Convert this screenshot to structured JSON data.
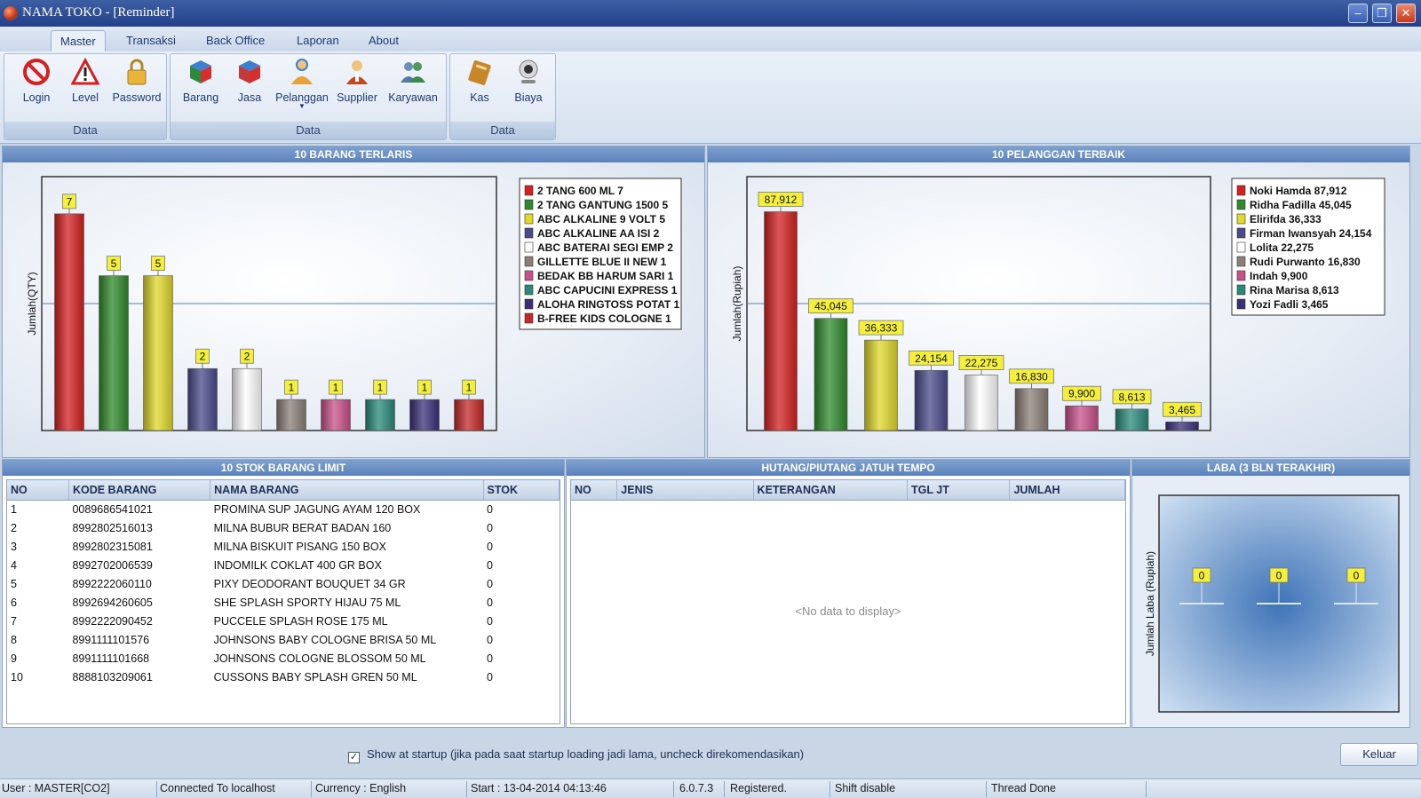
{
  "window": {
    "title": "NAMA TOKO - [Reminder]"
  },
  "menu": {
    "tabs": [
      "Master",
      "Transaksi",
      "Back Office",
      "Laporan",
      "About"
    ]
  },
  "ribbon": {
    "groups": [
      {
        "caption": "Data",
        "buttons": [
          {
            "label": "Login",
            "icon": "no-entry-icon"
          },
          {
            "label": "Level",
            "icon": "warning-icon"
          },
          {
            "label": "Password",
            "icon": "padlock-icon"
          }
        ]
      },
      {
        "caption": "Data",
        "buttons": [
          {
            "label": "Barang",
            "icon": "cube-icon"
          },
          {
            "label": "Jasa",
            "icon": "cube-icon"
          },
          {
            "label": "Pelanggan",
            "icon": "customer-icon"
          },
          {
            "label": "Supplier",
            "icon": "supplier-icon"
          },
          {
            "label": "Karyawan",
            "icon": "employees-icon"
          }
        ]
      },
      {
        "caption": "Data",
        "buttons": [
          {
            "label": "Kas",
            "icon": "book-icon"
          },
          {
            "label": "Biaya",
            "icon": "webcam-icon"
          }
        ]
      }
    ]
  },
  "panels": {
    "top_products": "10 BARANG TERLARIS",
    "top_customers": "10 PELANGGAN TERBAIK",
    "stock_limit": "10 STOK BARANG LIMIT",
    "due": "HUTANG/PIUTANG JATUH TEMPO",
    "profit": "LABA (3 BLN TERAKHIR)"
  },
  "chart_data": [
    {
      "type": "bar",
      "ylabel": "Jumlah(QTY)",
      "categories": [
        "2 TANG 600 ML",
        "2 TANG GANTUNG 1500",
        "ABC ALKALINE 9 VOLT",
        "ABC ALKALINE AA ISI",
        "ABC BATERAI SEGI EMP",
        "GILLETTE BLUE II NEW",
        "BEDAK BB HARUM SARI",
        "ABC CAPUCINI EXPRESS",
        "ALOHA RINGTOSS POTAT",
        "B-FREE KIDS COLOGNE"
      ],
      "values": [
        7,
        5,
        5,
        2,
        2,
        1,
        1,
        1,
        1,
        1
      ],
      "data_labels": [
        "7",
        "5",
        "5",
        "2",
        "2",
        "1",
        "1",
        "1",
        "1",
        "1"
      ],
      "legend": [
        "2 TANG 600 ML 7",
        "2 TANG GANTUNG 1500  5",
        "ABC ALKALINE 9 VOLT 5",
        "ABC ALKALINE AA ISI  2",
        "ABC BATERAI SEGI EMP 2",
        "GILLETTE BLUE II NEW 1",
        "BEDAK BB HARUM SARI  1",
        "ABC CAPUCINI EXPRESS 1",
        "ALOHA RINGTOSS POTAT 1",
        "B-FREE KIDS COLOGNE  1"
      ],
      "ylim": [
        0,
        8.2
      ],
      "colors": [
        "#d42020",
        "#2f8a2c",
        "#e0d82a",
        "#4a4a8c",
        "#ffffff",
        "#8c7f78",
        "#c8508a",
        "#2a8a7a",
        "#3a2f78",
        "#c42828"
      ],
      "legend_position": "top-right"
    },
    {
      "type": "bar",
      "ylabel": "Jumlah(Rupiah)",
      "categories": [
        "Noki Hamda",
        "Ridha Fadilla",
        "Elirifda",
        "Firman Iwansyah",
        "Lolita",
        "Rudi Purwanto",
        "Indah",
        "Rina Marisa",
        "Yozi Fadli"
      ],
      "values": [
        87912,
        45045,
        36333,
        24154,
        22275,
        16830,
        9900,
        8613,
        3465
      ],
      "data_labels": [
        "87,912",
        "45,045",
        "36,333",
        "24,154",
        "22,275",
        "16,830",
        "9,900",
        "8,613",
        "3,465"
      ],
      "legend": [
        "Noki Hamda 87,912",
        "Ridha Fadilla 45,045",
        "Elirifda 36,333",
        "Firman Iwansyah 24,154",
        "Lolita 22,275",
        "Rudi Purwanto 16,830",
        "Indah 9,900",
        "Rina Marisa 8,613",
        "Yozi Fadli 3,465"
      ],
      "ylim": [
        0,
        102000
      ],
      "colors": [
        "#d42020",
        "#2f8a2c",
        "#e0d82a",
        "#4a4a8c",
        "#ffffff",
        "#8c7f78",
        "#c8508a",
        "#2a8a7a",
        "#3a2f78"
      ],
      "legend_position": "top-right"
    },
    {
      "type": "bar",
      "ylabel": "Jumlah Laba (Rupiah)",
      "categories": [
        "",
        "",
        ""
      ],
      "values": [
        0,
        0,
        0
      ],
      "data_labels": [
        "0",
        "0",
        "0"
      ]
    }
  ],
  "stock_table": {
    "columns": [
      "NO",
      "KODE BARANG",
      "NAMA BARANG",
      "STOK"
    ],
    "rows": [
      [
        "1",
        "0089686541021",
        "PROMINA SUP JAGUNG AYAM 120 BOX",
        "0"
      ],
      [
        "2",
        "8992802516013",
        "MILNA BUBUR BERAT BADAN 160",
        "0"
      ],
      [
        "3",
        "8992802315081",
        "MILNA BISKUIT PISANG 150 BOX",
        "0"
      ],
      [
        "4",
        "8992702006539",
        "INDOMILK COKLAT 400 GR BOX",
        "0"
      ],
      [
        "5",
        "8992222060110",
        "PIXY DEODORANT BOUQUET 34 GR",
        "0"
      ],
      [
        "6",
        "8992694260605",
        "SHE SPLASH SPORTY HIJAU 75 ML",
        "0"
      ],
      [
        "7",
        "8992222090452",
        "PUCCELE SPLASH ROSE 175 ML",
        "0"
      ],
      [
        "8",
        "8991111101576",
        "JOHNSONS BABY COLOGNE BRISA 50 ML",
        "0"
      ],
      [
        "9",
        "8991111101668",
        "JOHNSONS COLOGNE BLOSSOM 50 ML",
        "0"
      ],
      [
        "10",
        "8888103209061",
        "CUSSONS BABY SPLASH GREN 50 ML",
        "0"
      ]
    ]
  },
  "due_table": {
    "columns": [
      "NO",
      "JENIS",
      "KETERANGAN",
      "TGL JT",
      "JUMLAH"
    ],
    "empty_text": "<No data to display>"
  },
  "footer": {
    "startup_label": "Show at startup (jika pada saat startup loading jadi lama, uncheck direkomendasikan)",
    "startup_checked": true,
    "exit_button": "Keluar"
  },
  "status": [
    "User : MASTER[CO2]",
    "Connected To localhost",
    "Currency : English",
    "Start  : 13-04-2014 04:13:46",
    "6.0.7.3",
    "Registered.",
    "Shift disable",
    "Thread Done"
  ]
}
